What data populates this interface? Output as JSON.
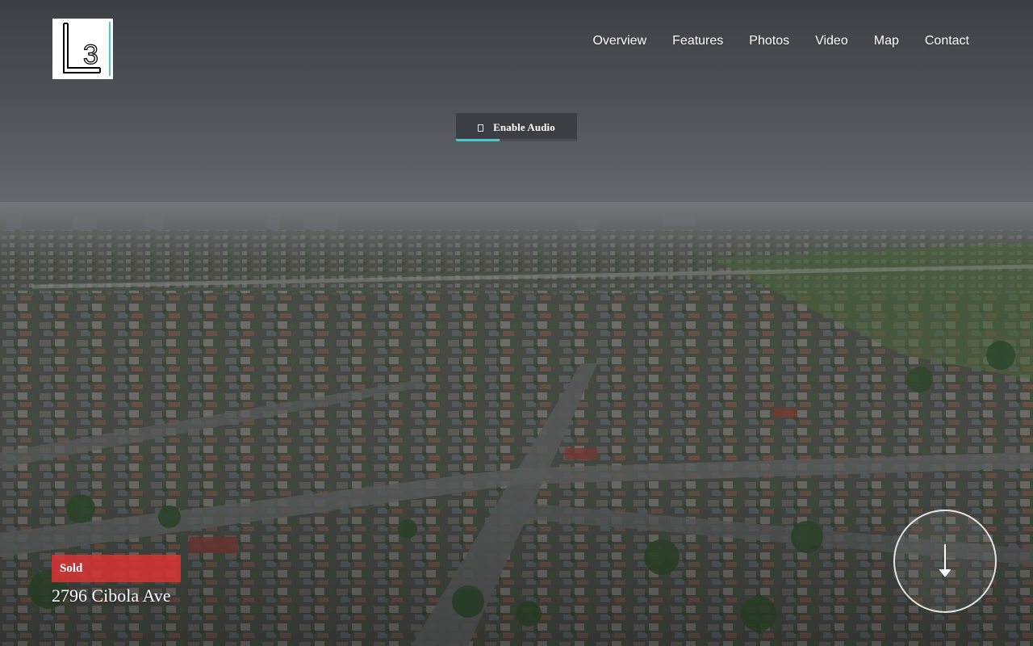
{
  "logo": {
    "text": "L3"
  },
  "nav": {
    "items": [
      {
        "label": "Overview"
      },
      {
        "label": "Features"
      },
      {
        "label": "Photos"
      },
      {
        "label": "Video"
      },
      {
        "label": "Map"
      },
      {
        "label": "Contact"
      }
    ]
  },
  "audio": {
    "label": "Enable Audio",
    "icon": "speaker-icon",
    "progress": 0.36
  },
  "property": {
    "status": "Sold",
    "address": "2796 Cibola Ave"
  },
  "scroll": {
    "icon": "arrow-down-icon"
  },
  "colors": {
    "accent": "#4dc7d0",
    "sold": "#d63434",
    "sky": "#6f7479"
  }
}
